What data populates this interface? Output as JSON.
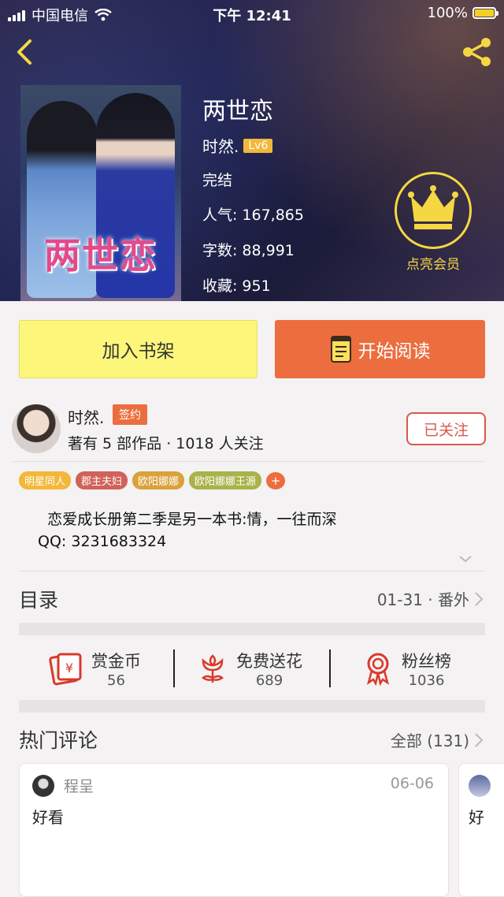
{
  "status_bar": {
    "carrier": "中国电信",
    "time": "下午 12:41",
    "battery": "100%"
  },
  "book": {
    "title": "两世恋",
    "cover_text": "两世恋",
    "author": "时然.",
    "level": "Lv6",
    "status": "完结",
    "stats": [
      {
        "label": "人气:",
        "value": "167,865"
      },
      {
        "label": "字数:",
        "value": "88,991"
      },
      {
        "label": "收藏:",
        "value": "951"
      }
    ]
  },
  "vip": {
    "label": "点亮会员"
  },
  "actions": {
    "add_shelf": "加入书架",
    "start_read": "开始阅读"
  },
  "author_info": {
    "name": "时然.",
    "badge": "签约",
    "summary": "著有 5 部作品 · 1018 人关注",
    "follow_label": "已关注"
  },
  "tags": [
    {
      "label": "明星同人",
      "color": "#f3b73a"
    },
    {
      "label": "郡主夫妇",
      "color": "#d1625a"
    },
    {
      "label": "欧阳娜娜",
      "color": "#d9a23c"
    },
    {
      "label": "欧阳娜娜王源",
      "color": "#a9b34a"
    }
  ],
  "tag_add": "+",
  "intro": {
    "line1": "  恋爱成长册第二季是另一本书:情，一往而深",
    "line2": "QQ: 3231683324"
  },
  "toc": {
    "title": "目录",
    "range": "01-31 · 番外"
  },
  "rewards": [
    {
      "label": "赏金币",
      "value": "56",
      "icon": "red-envelope-icon"
    },
    {
      "label": "免费送花",
      "value": "689",
      "icon": "flower-icon"
    },
    {
      "label": "粉丝榜",
      "value": "1036",
      "icon": "ribbon-medal-icon"
    }
  ],
  "hot_comments": {
    "title": "热门评论",
    "all_label": "全部 (131)",
    "items": [
      {
        "user": "程呈",
        "date": "06-06",
        "text": "好看"
      },
      {
        "text": "好"
      }
    ]
  },
  "colors": {
    "accent_orange": "#ec6d3e",
    "shelf_yellow": "#fcf67b",
    "vip_gold": "#f5d743"
  }
}
